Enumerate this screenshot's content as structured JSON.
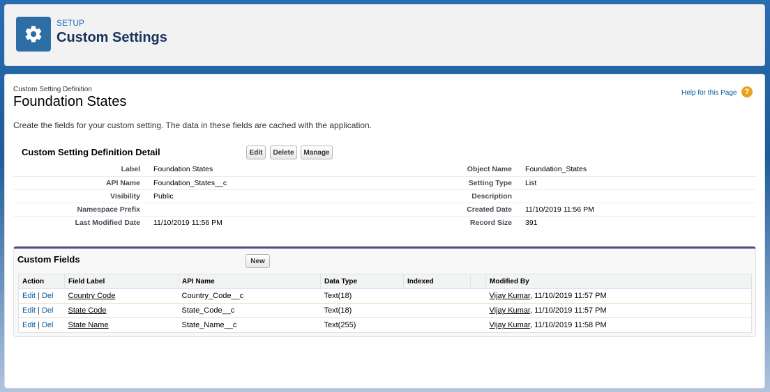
{
  "header": {
    "eyebrow": "SETUP",
    "title": "Custom Settings",
    "icon": "gear-icon"
  },
  "page": {
    "type_label": "Custom Setting Definition",
    "title": "Foundation States",
    "help_link": "Help for this Page",
    "help_icon": "?",
    "description": "Create the fields for your custom setting. The data in these fields are cached with the application."
  },
  "detail": {
    "title": "Custom Setting Definition Detail",
    "buttons": {
      "edit": "Edit",
      "delete": "Delete",
      "manage": "Manage"
    },
    "rows": [
      {
        "l1": "Label",
        "v1": "Foundation States",
        "l2": "Object Name",
        "v2": "Foundation_States"
      },
      {
        "l1": "API Name",
        "v1": "Foundation_States__c",
        "l2": "Setting Type",
        "v2": "List"
      },
      {
        "l1": "Visibility",
        "v1": "Public",
        "l2": "Description",
        "v2": ""
      },
      {
        "l1": "Namespace Prefix",
        "v1": "",
        "l2": "Created Date",
        "v2": "11/10/2019 11:56 PM"
      },
      {
        "l1": "Last Modified Date",
        "v1": "11/10/2019 11:56 PM",
        "l2": "Record Size",
        "v2": "391"
      }
    ]
  },
  "custom_fields": {
    "title": "Custom Fields",
    "new_button": "New",
    "columns": [
      "Action",
      "Field Label",
      "API Name",
      "Data Type",
      "Indexed",
      "",
      "Modified By"
    ],
    "edit_label": "Edit",
    "del_label": "Del",
    "separator": "|",
    "rows": [
      {
        "field_label": "Country Code",
        "api_name": "Country_Code__c",
        "data_type": "Text(18)",
        "indexed": "",
        "modified_user": "Vijay Kumar",
        "modified_date": ", 11/10/2019 11:57 PM"
      },
      {
        "field_label": "State Code",
        "api_name": "State_Code__c",
        "data_type": "Text(18)",
        "indexed": "",
        "modified_user": "Vijay Kumar",
        "modified_date": ", 11/10/2019 11:57 PM"
      },
      {
        "field_label": "State Name",
        "api_name": "State_Name__c",
        "data_type": "Text(255)",
        "indexed": "",
        "modified_user": "Vijay Kumar",
        "modified_date": ", 11/10/2019 11:58 PM"
      }
    ]
  },
  "colors": {
    "accent": "#2d6ea5",
    "link": "#015ba7",
    "section_border": "#56458c",
    "help_icon": "#e9a21f"
  }
}
